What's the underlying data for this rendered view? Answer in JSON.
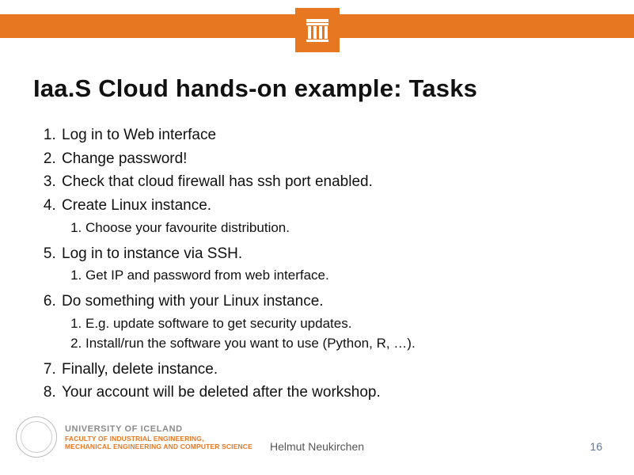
{
  "title": "Iaa.S Cloud hands-on example: Tasks",
  "list": {
    "i1": "Log in to Web interface",
    "i2": "Change password!",
    "i3": "Check that cloud firewall has ssh port enabled.",
    "i4": "Create Linux instance.",
    "i4s1": "Choose your favourite distribution.",
    "i5": "Log in to instance via SSH.",
    "i5s1": "Get IP and password from web interface.",
    "i6": "Do something with your Linux instance.",
    "i6s1": "E.g. update software to get security updates.",
    "i6s2": "Install/run the software you want to use (Python, R, …).",
    "i7": "Finally, delete instance.",
    "i8": "Your account will be deleted after the workshop."
  },
  "university": {
    "name": "UNIVERSITY OF ICELAND",
    "faculty1": "FACULTY OF INDUSTRIAL ENGINEERING,",
    "faculty2": "MECHANICAL ENGINEERING AND COMPUTER SCIENCE"
  },
  "footer": {
    "author": "Helmut Neukirchen",
    "page": "16"
  },
  "colors": {
    "accent": "#e87722"
  }
}
